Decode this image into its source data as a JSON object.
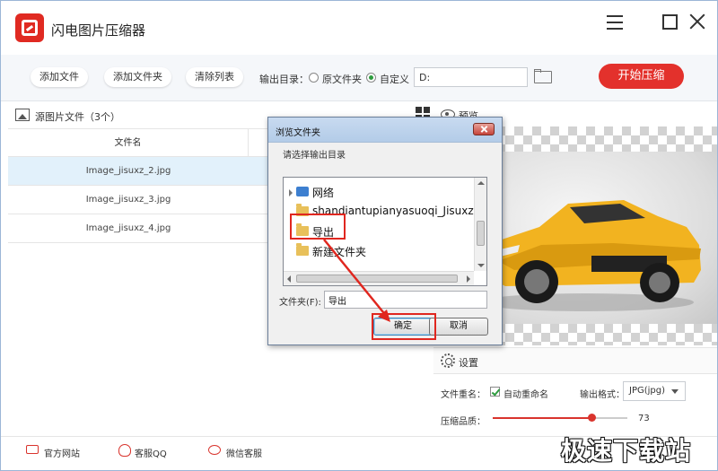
{
  "app": {
    "title": "闪电图片压缩器"
  },
  "toolbar": {
    "add_file": "添加文件",
    "add_folder": "添加文件夹",
    "clear_list": "清除列表",
    "output_dir_label": "输出目录：",
    "radio_source": "原文件夹",
    "radio_custom": "自定义",
    "output_path": "D:",
    "start": "开始压缩"
  },
  "file_panel": {
    "title": "源图片文件（3个）",
    "column_name": "文件名",
    "rows": [
      "Image_jisuxz_2.jpg",
      "Image_jisuxz_3.jpg",
      "Image_jisuxz_4.jpg"
    ]
  },
  "preview": {
    "title": "预览"
  },
  "settings": {
    "title": "设置",
    "rename_label": "文件重名：",
    "auto_rename": "自动重命名",
    "format_label": "输出格式：",
    "format_value": "JPG(jpg)",
    "quality_label": "压缩品质：",
    "quality_value": 73
  },
  "footer": {
    "website": "官方网站",
    "qq": "客服QQ",
    "wechat": "微信客服"
  },
  "watermark": "极速下载站",
  "dialog": {
    "title": "浏览文件夹",
    "prompt": "请选择输出目录",
    "tree": [
      "网络",
      "shandiantupianyasuoqi_Jisuxz.",
      "导出",
      "新建文件夹"
    ],
    "folder_label": "文件夹(F):",
    "folder_value": "导出",
    "ok": "确定",
    "cancel": "取消"
  },
  "colors": {
    "accent_red": "#e3312c",
    "selection_blue": "#e2f1fb",
    "check_green": "#2e9c3f"
  }
}
